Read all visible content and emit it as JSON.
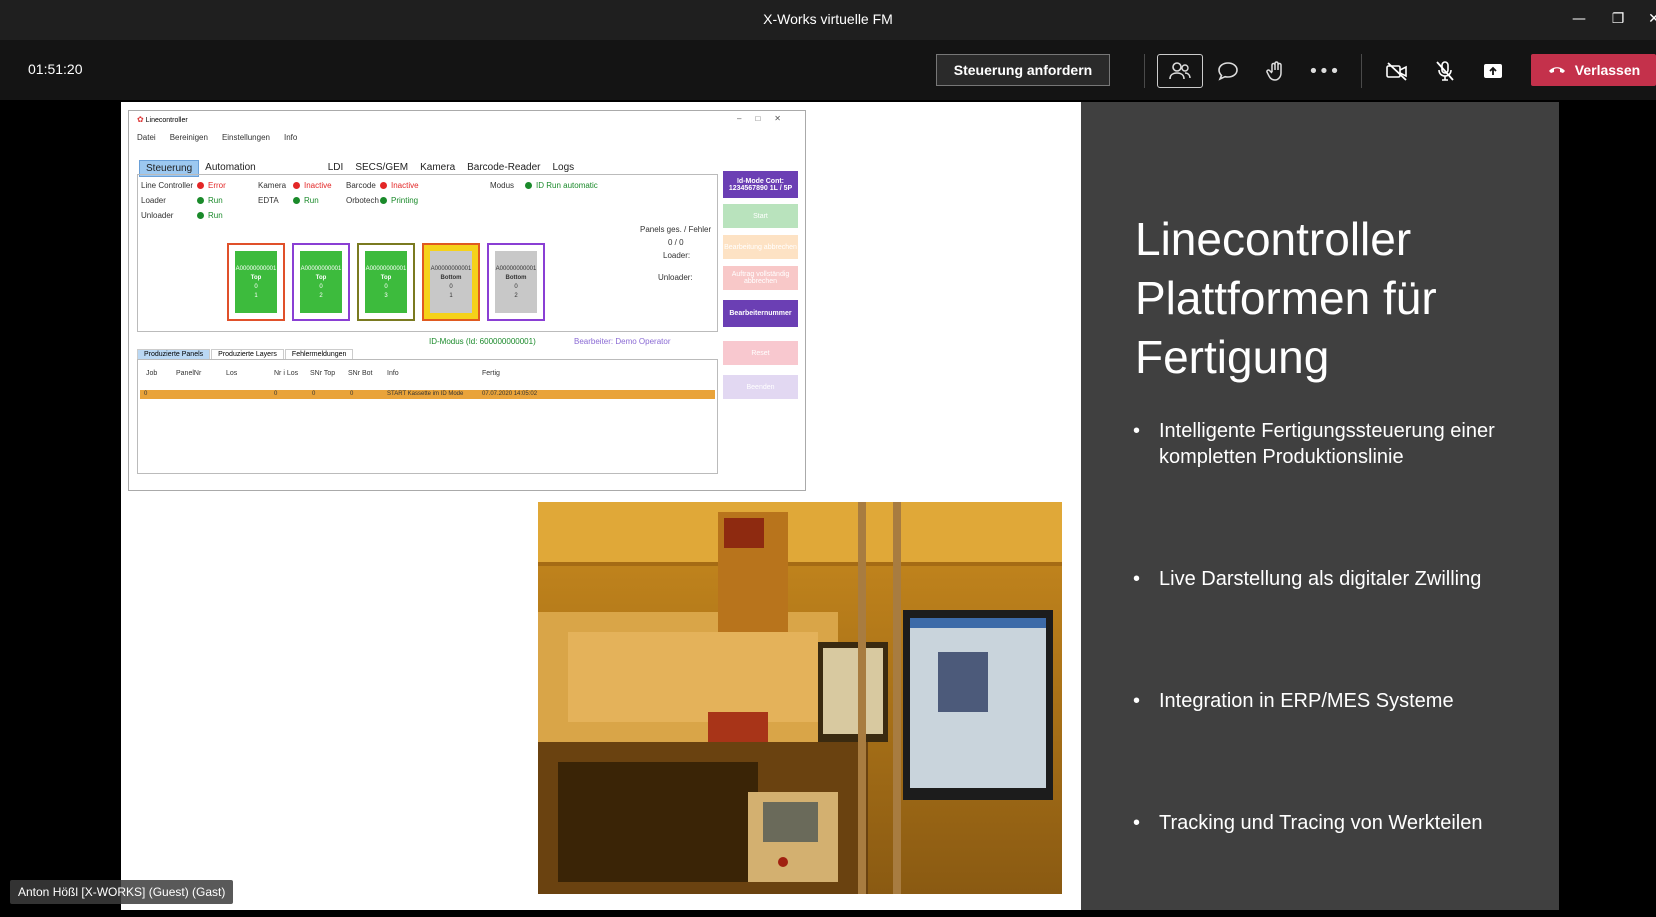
{
  "window": {
    "title": "X-Works virtuelle FM"
  },
  "toolbar": {
    "timer": "01:51:20",
    "request_control": "Steuerung anfordern",
    "leave": "Verlassen",
    "icons": [
      "people-icon",
      "chat-icon",
      "raise-hand-icon",
      "more-icon",
      "camera-off-icon",
      "mic-off-icon",
      "share-icon",
      "phone-icon"
    ]
  },
  "slide": {
    "title_lines": [
      "Linecontroller",
      "Plattformen für",
      "Fertigung"
    ],
    "bullets": [
      "Intelligente Fertigungssteuerung einer kompletten Produktionslinie",
      "Live Darstellung als digitaler Zwilling",
      "Integration in ERP/MES Systeme",
      "Tracking und Tracing von Werkteilen"
    ]
  },
  "linecontroller": {
    "title": "Linecontroller",
    "menu": [
      "Datei",
      "Bereinigen",
      "Einstellungen",
      "Info"
    ],
    "tabs": [
      "Steuerung",
      "Automation",
      "LDI",
      "SECS/GEM",
      "Kamera",
      "Barcode-Reader",
      "Logs"
    ],
    "status": {
      "line_controller": {
        "label": "Line Controller",
        "value": "Error"
      },
      "loader": {
        "label": "Loader",
        "value": "Run"
      },
      "unloader": {
        "label": "Unloader",
        "value": "Run"
      },
      "kamera": {
        "label": "Kamera",
        "value": "Inactive"
      },
      "edta": {
        "label": "EDTA",
        "value": "Run"
      },
      "barcode": {
        "label": "Barcode",
        "value": "Inactive"
      },
      "orbotech": {
        "label": "Orbotech",
        "value": "Printing"
      },
      "modus": {
        "label": "Modus",
        "value": "ID Run automatic"
      }
    },
    "panels_header": "Panels ges. / Fehler",
    "panels_count": "0 / 0",
    "loader_label": "Loader:",
    "unloader_label": "Unloader:",
    "cards": [
      {
        "id": "A00000000001",
        "side": "Top",
        "a": "0",
        "b": "1"
      },
      {
        "id": "A00000000001",
        "side": "Top",
        "a": "0",
        "b": "2"
      },
      {
        "id": "A00000000001",
        "side": "Top",
        "a": "0",
        "b": "3"
      },
      {
        "id": "A00000000001",
        "side": "Bottom",
        "a": "0",
        "b": "1"
      },
      {
        "id": "A00000000001",
        "side": "Bottom",
        "a": "0",
        "b": "2"
      }
    ],
    "id_mode_text": "ID-Modus  (Id: 600000000001)",
    "operator_text": "Bearbeiter: Demo Operator",
    "side_buttons": {
      "idmode": "Id-Mode Cont: 1234567890 1L / 5P",
      "start": "Start",
      "b3": "Bearbeitung abbrechen",
      "b4": "Auftrag vollständig abbrechen",
      "operator": "Bearbeiternummer",
      "b6": "Reset",
      "b7": "Beenden"
    },
    "subtabs": [
      "Produzierte Panels",
      "Produzierte Layers",
      "Fehlermeldungen"
    ],
    "columns": [
      "Job",
      "PanelNr",
      "Los",
      "Nr i Los",
      "SNr Top",
      "SNr Bot",
      "Info",
      "Fertig"
    ],
    "row": {
      "job": "0",
      "los": "0",
      "nr": "0",
      "snr": "0",
      "info": "START Kassette im ID Mode",
      "fertig": "07.07.2020 14:05:02"
    }
  },
  "participant": {
    "name": "Anton Hößl [X-WORKS] (Guest) (Gast)"
  },
  "colors": {
    "leave": "#c4314b",
    "slide_dark": "#404040",
    "card_green": "#3dbb3d",
    "card_gray": "#c8c8c8",
    "orange_row": "#e9a33a",
    "side_purple": "#6b3fb4"
  }
}
